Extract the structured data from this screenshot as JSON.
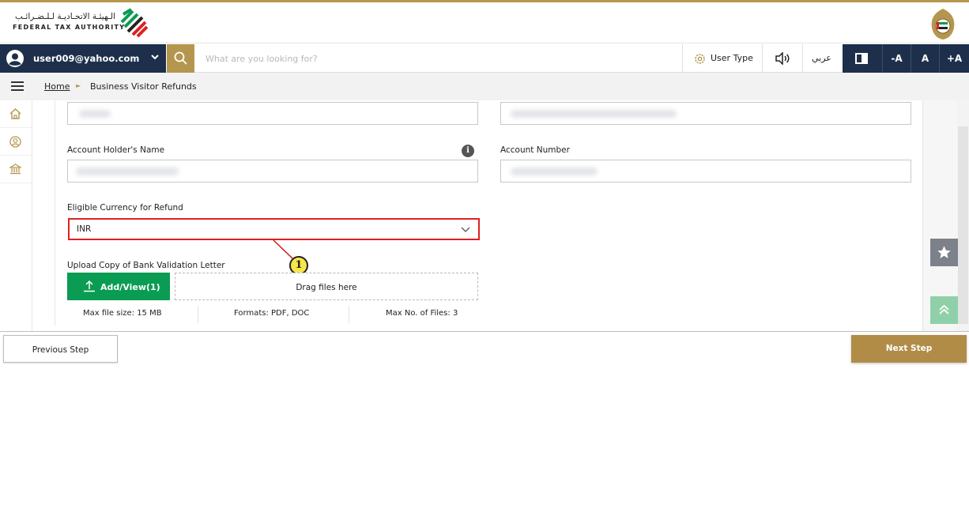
{
  "header": {
    "logo_arabic": "الـهيئـة الاتحـاديـة لـلـضـرائـب",
    "logo_english": "FEDERAL TAX AUTHORITY"
  },
  "toolbar": {
    "user_email": "user009@yahoo.com",
    "search_placeholder": "What are you looking for?",
    "user_type_label": "User Type",
    "language_label": "عربي",
    "font_decrease": "-A",
    "font_reset": "A",
    "font_increase": "+A"
  },
  "breadcrumb": {
    "home": "Home",
    "separator": "►",
    "current": "Business Visitor Refunds"
  },
  "form": {
    "account_holder_label": "Account Holder's Name",
    "account_number_label": "Account Number",
    "currency_label": "Eligible Currency for Refund",
    "currency_value": "INR",
    "upload_label": "Upload Copy of Bank Validation Letter",
    "add_button": "Add/View(1)",
    "dropzone_text": "Drag files here",
    "max_size": "Max file size: 15 MB",
    "formats": "Formats: PDF, DOC",
    "max_files": "Max No. of Files: 3",
    "info_glyph": "i"
  },
  "annotation": {
    "callout_number": "1"
  },
  "footer": {
    "previous_label": "Previous Step",
    "next_label": "Next Step"
  },
  "colors": {
    "gold": "#b5964e",
    "navy": "#1d2f4b",
    "green": "#0a9c52",
    "highlight_red": "#e02020"
  }
}
